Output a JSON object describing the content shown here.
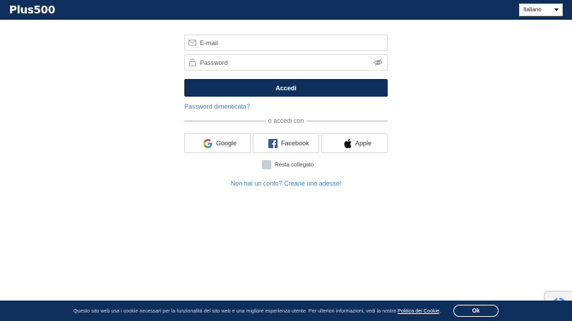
{
  "header": {
    "logo_text": "Plus500",
    "language_selected": "Italiano"
  },
  "login_form": {
    "email_placeholder": "E-mail",
    "password_placeholder": "Password",
    "submit_label": "Accedi",
    "forgot_password": "Password dimenticata?",
    "divider_text": "o accedi con",
    "social": {
      "google": "Google",
      "facebook": "Facebook",
      "apple": "Apple"
    },
    "remember_label": "Resta collegato",
    "remember_checked": false,
    "signup_link": "Non hai un conto? Creane uno adesso!"
  },
  "cookie_banner": {
    "text": "Questo sito web usa i cookie necessari per la funzionalità del sito web e una migliore esperienza utente. Per ulteriori informazioni, vedi la nostra ",
    "link": "Politica dei Cookie",
    "text_end": ".",
    "ok_label": "Ok"
  },
  "colors": {
    "brand_navy": "#0e2f5c",
    "link_blue": "#3f7fc4",
    "facebook_blue": "#3b5998"
  },
  "icons": [
    "envelope-icon",
    "lock-icon",
    "eye-slash-icon",
    "google-icon",
    "facebook-icon",
    "apple-icon",
    "recaptcha-icon",
    "chevron-down-icon"
  ]
}
